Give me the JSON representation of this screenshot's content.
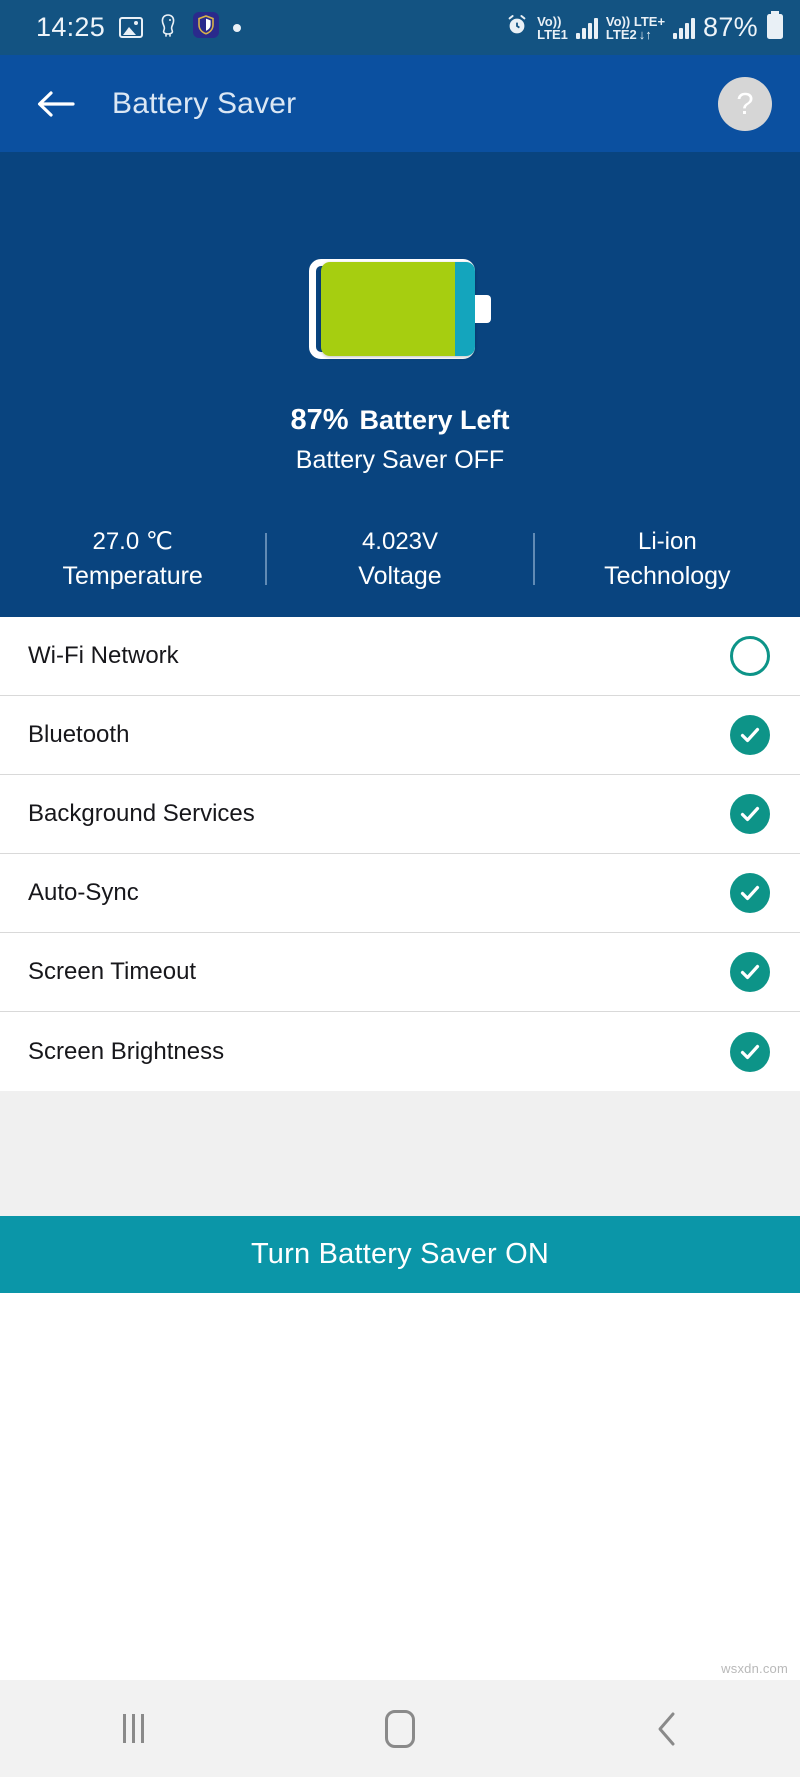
{
  "statusbar": {
    "time": "14:25",
    "icons": [
      "image-icon",
      "bird-icon",
      "shield-app-icon",
      "dot-indicator"
    ],
    "sim1": {
      "line1": "Vo))",
      "line2": "LTE1"
    },
    "sim2": {
      "line1": "Vo))",
      "line2": "LTE2",
      "network": "LTE+",
      "data": "↓↑"
    },
    "alarm": "alarm-icon",
    "battery_percent": "87%"
  },
  "appbar": {
    "back": "back-arrow-icon",
    "title": "Battery Saver",
    "help": "?"
  },
  "hero": {
    "battery_level": 87,
    "battery_percent_label": "87%",
    "battery_left_label": "Battery Left",
    "saver_status": "Battery Saver OFF",
    "fill_color": "#a6ce10",
    "remainder_color": "#14a5bd",
    "stats": [
      {
        "value": "27.0 ℃",
        "label": "Temperature"
      },
      {
        "value": "4.023V",
        "label": "Voltage"
      },
      {
        "value": "Li-ion",
        "label": "Technology"
      }
    ]
  },
  "settings": {
    "accent_color": "#0d9488",
    "items": [
      {
        "label": "Wi-Fi Network",
        "checked": false
      },
      {
        "label": "Bluetooth",
        "checked": true
      },
      {
        "label": "Background Services",
        "checked": true
      },
      {
        "label": "Auto-Sync",
        "checked": true
      },
      {
        "label": "Screen Timeout",
        "checked": true
      },
      {
        "label": "Screen Brightness",
        "checked": true
      }
    ]
  },
  "cta": {
    "label": "Turn Battery Saver ON",
    "color": "#0b96a8"
  },
  "watermark": "wsxdn.com",
  "navbar": {
    "recents": "recents-icon",
    "home": "home-icon",
    "back": "back-icon"
  }
}
